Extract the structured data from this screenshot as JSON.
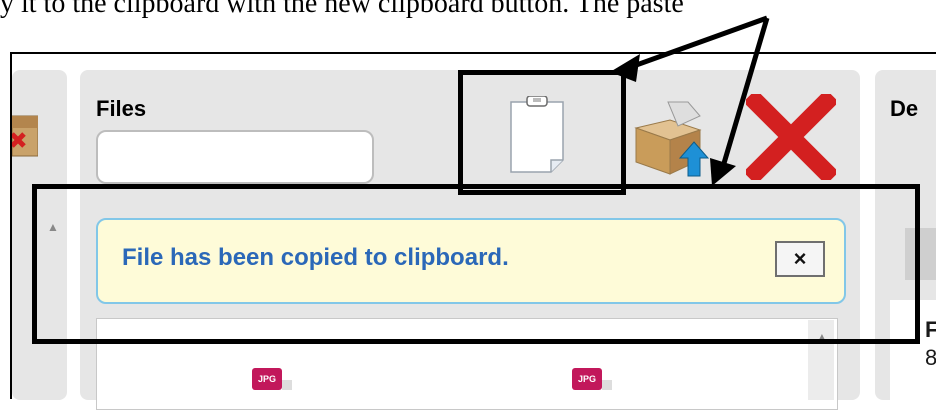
{
  "caption": {
    "text": "y it to the clipboard with the new clipboard button. The paste"
  },
  "files_panel": {
    "title": "Files",
    "search_value": "",
    "toolbar": {
      "clipboard_icon": "clipboard-icon",
      "upload_icon": "box-upload-icon",
      "delete_icon": "delete-x-icon"
    }
  },
  "notification": {
    "text": "File has been copied to clipboard.",
    "close_label": "×"
  },
  "files": [
    {
      "type_badge": "JPG"
    },
    {
      "type_badge": "JPG"
    }
  ],
  "right_panel": {
    "title": "De",
    "item_label": "F",
    "item_value": "8"
  },
  "colors": {
    "notification_bg": "#fefbd8",
    "notification_border": "#82c7e8",
    "notification_text": "#2b68b8",
    "delete_red": "#d32020",
    "jpg_badge": "#c2185b"
  }
}
